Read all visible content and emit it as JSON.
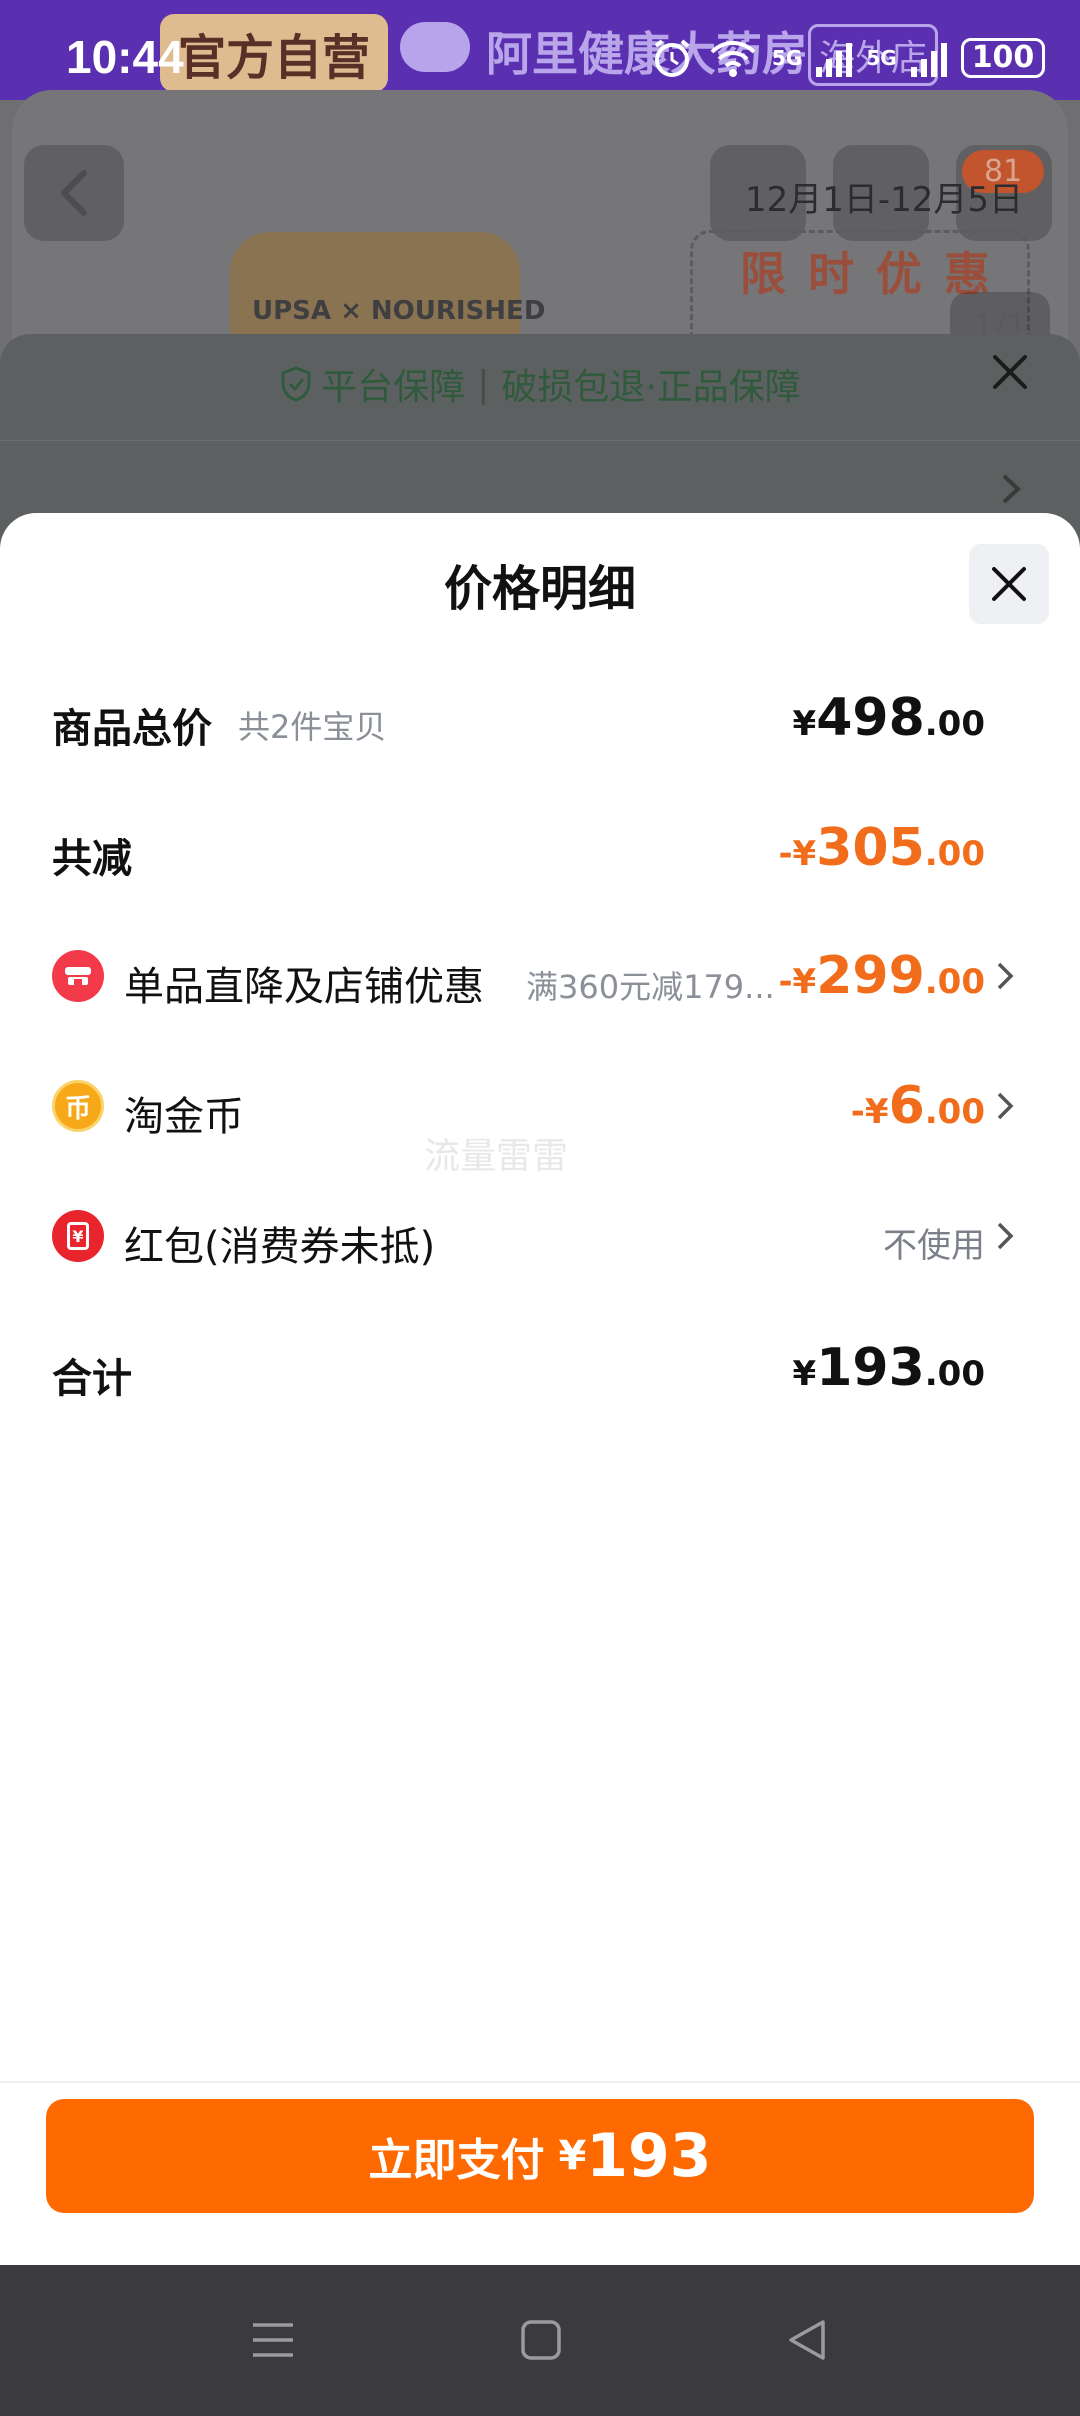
{
  "status_bar": {
    "time": "10:44",
    "net1": "5G",
    "net2": "5G",
    "battery": "100"
  },
  "background": {
    "official_tag": "官方自营",
    "store_name": "阿里健康大药房",
    "store_tag": "海外店",
    "cart_badge": "81",
    "promo_date": "12月1日-12月5日",
    "promo_text": "限时优惠",
    "image_counter": "1/1",
    "brand": "UPSA × NOURISHED",
    "guarantee_title": "平台保障",
    "guarantee_detail": "破损包退·正品保障"
  },
  "sheet": {
    "title": "价格明细",
    "rows": {
      "total": {
        "label": "商品总价",
        "sub": "共2件宝贝",
        "currency": "¥",
        "int": "498",
        "dec": ".00"
      },
      "reduce": {
        "label": "共减",
        "currency": "-¥",
        "int": "305",
        "dec": ".00"
      },
      "shop_discount": {
        "label": "单品直降及店铺优惠",
        "sub": "满360元减179...",
        "currency": "-¥",
        "int": "299",
        "dec": ".00",
        "icon": "shop-icon"
      },
      "coins": {
        "label": "淘金币",
        "currency": "-¥",
        "int": "6",
        "dec": ".00",
        "icon": "coin-icon",
        "icon_glyph": "币"
      },
      "red_packet": {
        "label": "红包(消费券未抵)",
        "value": "不使用",
        "icon": "red-packet-icon",
        "icon_glyph": "¥"
      },
      "sum": {
        "label": "合计",
        "currency": "¥",
        "int": "193",
        "dec": ".00"
      }
    },
    "watermark": "流量雷雷",
    "pay_button": {
      "label": "立即支付",
      "currency": "¥",
      "value": "193"
    }
  },
  "colors": {
    "accent_orange": "#ff6a00",
    "discount_orange": "#f26d1b",
    "shop_icon_red": "#f23a4a",
    "coin_gold": "#f7a818",
    "red_packet": "#e8252d"
  }
}
